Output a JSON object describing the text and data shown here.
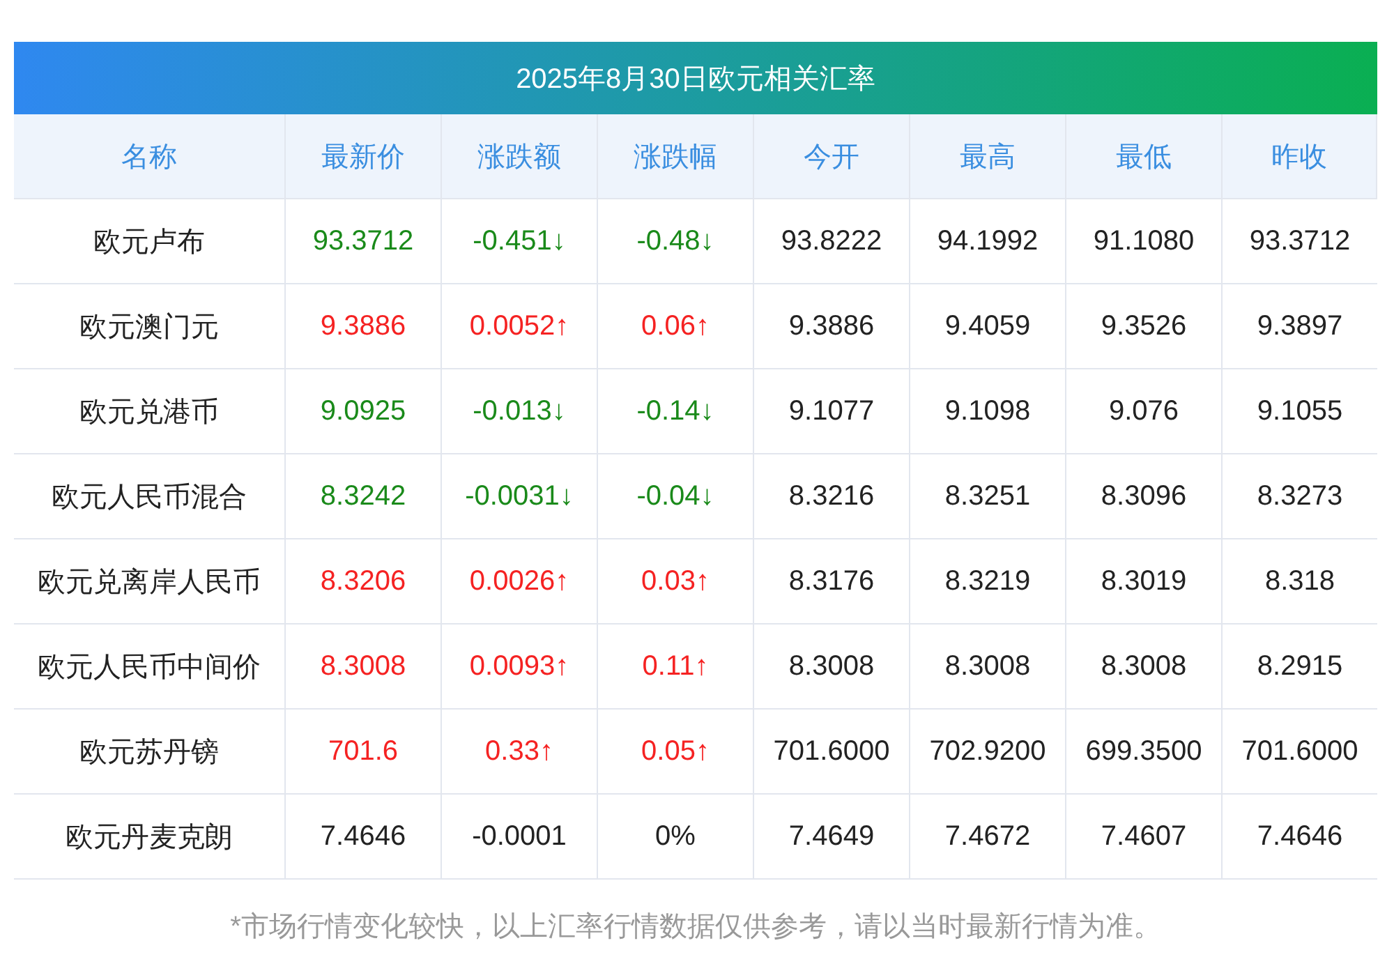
{
  "title": "2025年8月30日欧元相关汇率",
  "columns": [
    "名称",
    "最新价",
    "涨跌额",
    "涨跌幅",
    "今开",
    "最高",
    "最低",
    "昨收"
  ],
  "rows": [
    {
      "color": "#1a8a1a",
      "cells": [
        "欧元卢布",
        "93.3712",
        "-0.451↓",
        "-0.48↓",
        "93.8222",
        "94.1992",
        "91.1080",
        "93.3712"
      ]
    },
    {
      "color": "#f52222",
      "cells": [
        "欧元澳门元",
        "9.3886",
        "0.0052↑",
        "0.06↑",
        "9.3886",
        "9.4059",
        "9.3526",
        "9.3897"
      ]
    },
    {
      "color": "#1a8a1a",
      "cells": [
        "欧元兑港币",
        "9.0925",
        "-0.013↓",
        "-0.14↓",
        "9.1077",
        "9.1098",
        "9.076",
        "9.1055"
      ]
    },
    {
      "color": "#1a8a1a",
      "cells": [
        "欧元人民币混合",
        "8.3242",
        "-0.0031↓",
        "-0.04↓",
        "8.3216",
        "8.3251",
        "8.3096",
        "8.3273"
      ]
    },
    {
      "color": "#f52222",
      "cells": [
        "欧元兑离岸人民币",
        "8.3206",
        "0.0026↑",
        "0.03↑",
        "8.3176",
        "8.3219",
        "8.3019",
        "8.318"
      ]
    },
    {
      "color": "#f52222",
      "cells": [
        "欧元人民币中间价",
        "8.3008",
        "0.0093↑",
        "0.11↑",
        "8.3008",
        "8.3008",
        "8.3008",
        "8.2915"
      ]
    },
    {
      "color": "#f52222",
      "cells": [
        "欧元苏丹镑",
        "701.6",
        "0.33↑",
        "0.05↑",
        "701.6000",
        "702.9200",
        "699.3500",
        "701.6000"
      ]
    },
    {
      "color": "#222222",
      "cells": [
        "欧元丹麦克朗",
        "7.4646",
        "-0.0001",
        "0%",
        "7.4649",
        "7.4672",
        "7.4607",
        "7.4646"
      ]
    }
  ],
  "note": "*市场行情变化较快，以上汇率行情数据仅供参考，请以当时最新行情为准。"
}
